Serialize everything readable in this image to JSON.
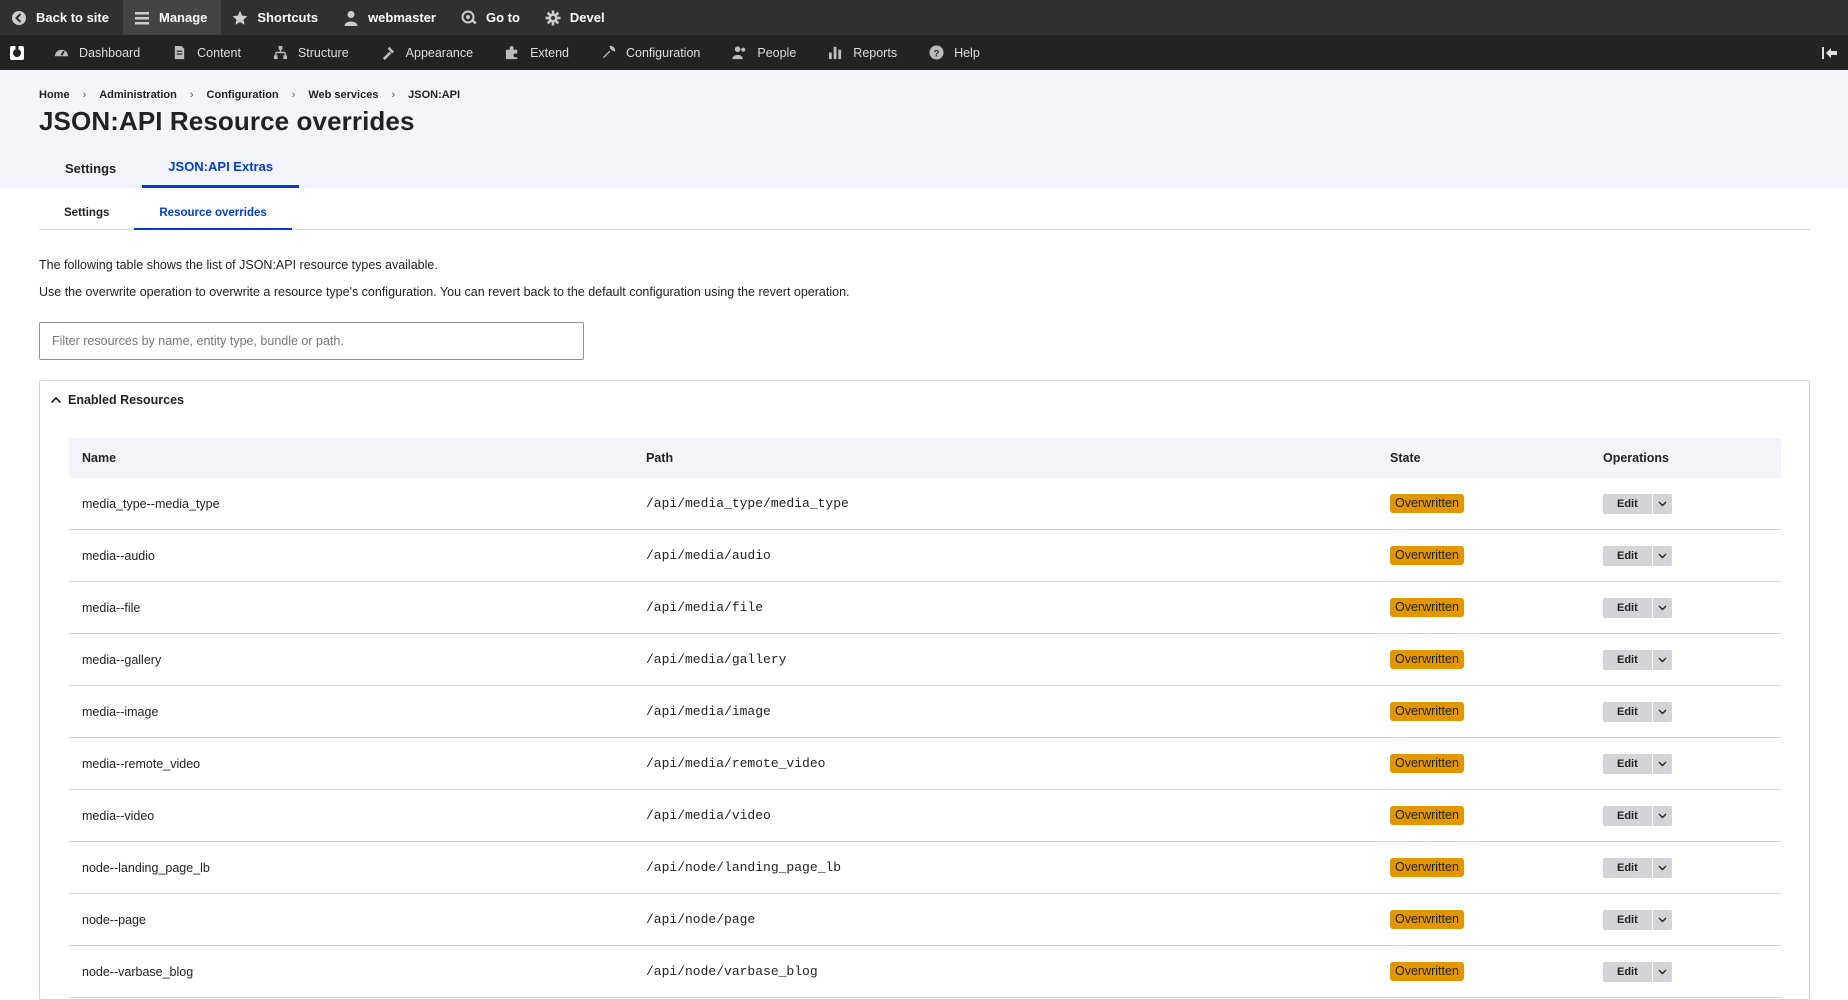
{
  "toolbar": {
    "back": "Back to site",
    "manage": "Manage",
    "shortcuts": "Shortcuts",
    "user": "webmaster",
    "goto": "Go to",
    "devel": "Devel"
  },
  "tray": [
    {
      "label": "Dashboard",
      "icon": "dashboard-icon"
    },
    {
      "label": "Content",
      "icon": "content-icon"
    },
    {
      "label": "Structure",
      "icon": "structure-icon"
    },
    {
      "label": "Appearance",
      "icon": "appearance-icon"
    },
    {
      "label": "Extend",
      "icon": "extend-icon"
    },
    {
      "label": "Configuration",
      "icon": "configuration-icon"
    },
    {
      "label": "People",
      "icon": "people-icon"
    },
    {
      "label": "Reports",
      "icon": "reports-icon"
    },
    {
      "label": "Help",
      "icon": "help-icon"
    }
  ],
  "breadcrumb": [
    "Home",
    "Administration",
    "Configuration",
    "Web services",
    "JSON:API"
  ],
  "page_title": "JSON:API Resource overrides",
  "primary_tabs": [
    "Settings",
    "JSON:API Extras"
  ],
  "secondary_tabs": [
    "Settings",
    "Resource overrides"
  ],
  "description": [
    "The following table shows the list of JSON:API resource types available.",
    "Use the overwrite operation to overwrite a resource type's configuration. You can revert back to the default configuration using the revert operation."
  ],
  "filter": {
    "placeholder": "Filter resources by name, entity type, bundle or path.",
    "value": ""
  },
  "details_title": "Enabled Resources",
  "table": {
    "headers": [
      "Name",
      "Path",
      "State",
      "Operations"
    ],
    "rows": [
      {
        "name": "media_type--media_type",
        "path": "/api/media_type/media_type",
        "state": "Overwritten",
        "op": "Edit"
      },
      {
        "name": "media--audio",
        "path": "/api/media/audio",
        "state": "Overwritten",
        "op": "Edit"
      },
      {
        "name": "media--file",
        "path": "/api/media/file",
        "state": "Overwritten",
        "op": "Edit"
      },
      {
        "name": "media--gallery",
        "path": "/api/media/gallery",
        "state": "Overwritten",
        "op": "Edit"
      },
      {
        "name": "media--image",
        "path": "/api/media/image",
        "state": "Overwritten",
        "op": "Edit"
      },
      {
        "name": "media--remote_video",
        "path": "/api/media/remote_video",
        "state": "Overwritten",
        "op": "Edit"
      },
      {
        "name": "media--video",
        "path": "/api/media/video",
        "state": "Overwritten",
        "op": "Edit"
      },
      {
        "name": "node--landing_page_lb",
        "path": "/api/node/landing_page_lb",
        "state": "Overwritten",
        "op": "Edit"
      },
      {
        "name": "node--page",
        "path": "/api/node/page",
        "state": "Overwritten",
        "op": "Edit"
      },
      {
        "name": "node--varbase_blog",
        "path": "/api/node/varbase_blog",
        "state": "Overwritten",
        "op": "Edit"
      }
    ]
  },
  "colors": {
    "accent": "#003ecc",
    "badge": "#e29700",
    "toolbar": "#303030"
  }
}
